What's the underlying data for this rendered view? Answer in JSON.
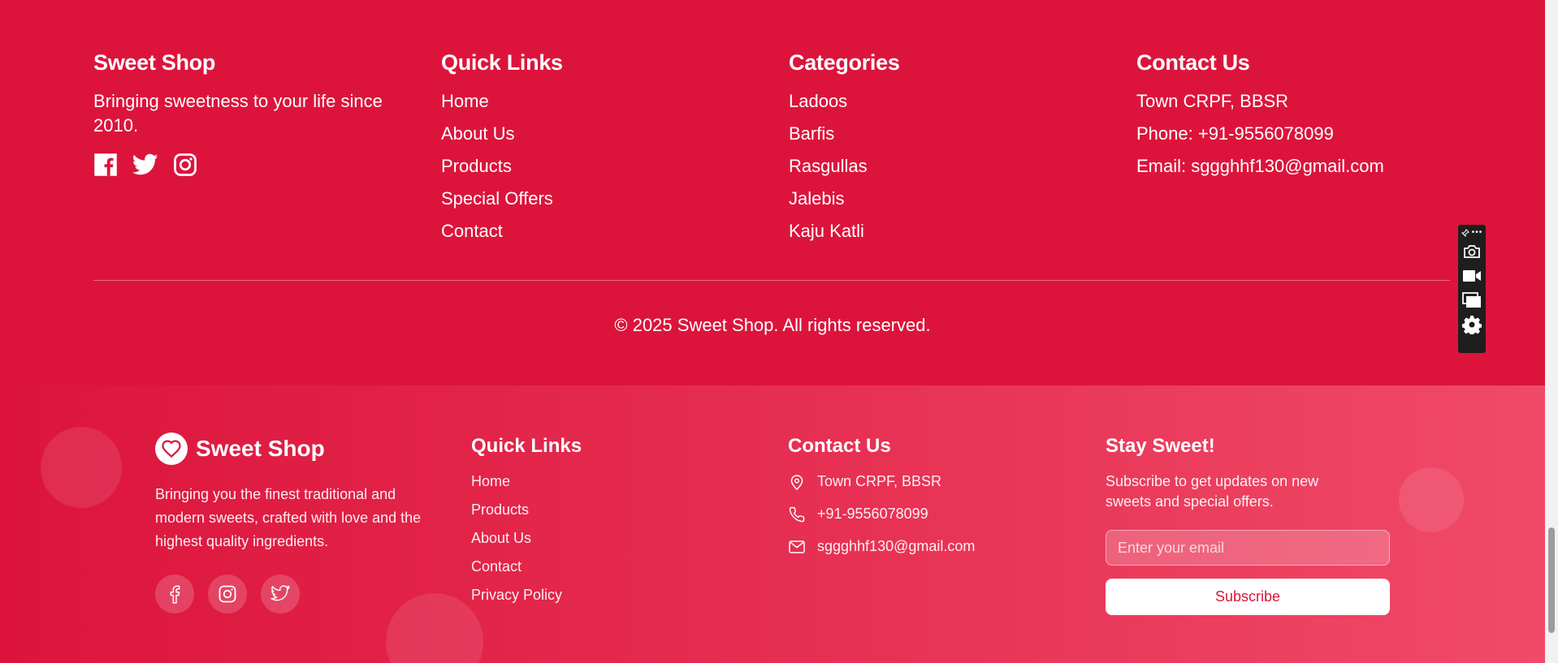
{
  "top_footer": {
    "about": {
      "title": "Sweet Shop",
      "text": "Bringing sweetness to your life since 2010.",
      "social": [
        "facebook-icon",
        "twitter-icon",
        "instagram-icon"
      ]
    },
    "quick_links": {
      "title": "Quick Links",
      "items": [
        "Home",
        "About Us",
        "Products",
        "Special Offers",
        "Contact"
      ]
    },
    "categories": {
      "title": "Categories",
      "items": [
        "Ladoos",
        "Barfis",
        "Rasgullas",
        "Jalebis",
        "Kaju Katli"
      ]
    },
    "contact": {
      "title": "Contact Us",
      "address": "Town CRPF, BBSR",
      "phone": "Phone: +91-9556078099",
      "email": "Email: sggghhf130@gmail.com"
    },
    "copyright": "© 2025 Sweet Shop. All rights reserved."
  },
  "bottom_footer": {
    "brand": {
      "name": "Sweet Shop",
      "description": "Bringing you the finest traditional and modern sweets, crafted with love and the highest quality ingredients.",
      "social": [
        "facebook-icon",
        "instagram-icon",
        "twitter-icon"
      ]
    },
    "quick_links": {
      "title": "Quick Links",
      "items": [
        "Home",
        "Products",
        "About Us",
        "Contact",
        "Privacy Policy"
      ]
    },
    "contact": {
      "title": "Contact Us",
      "address": "Town CRPF, BBSR",
      "phone": "+91-9556078099",
      "email": "sggghhf130@gmail.com"
    },
    "newsletter": {
      "title": "Stay Sweet!",
      "text": "Subscribe to get updates on new sweets and special offers.",
      "placeholder": "Enter your email",
      "button": "Subscribe"
    }
  },
  "colors": {
    "primary": "#dc143c",
    "gradient_end": "#f04a68",
    "white": "#ffffff"
  },
  "toolbar": {
    "icons": [
      "pin-icon",
      "more-icon",
      "camera-icon",
      "video-icon",
      "windows-icon",
      "gear-icon"
    ]
  }
}
